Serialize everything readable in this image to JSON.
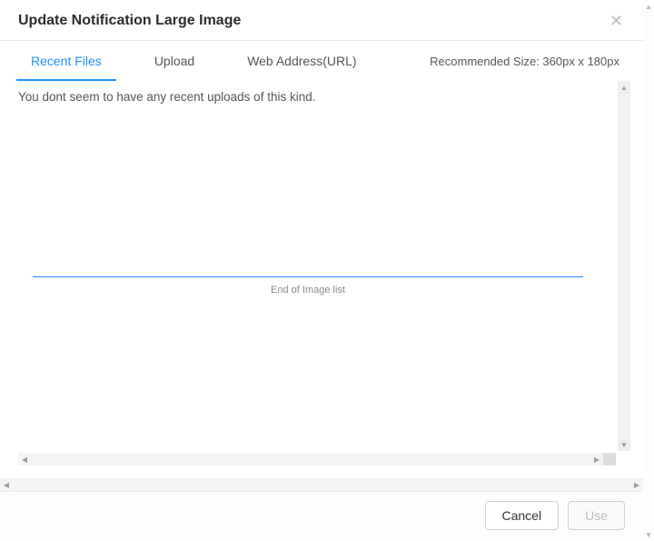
{
  "header": {
    "title": "Update Notification Large Image"
  },
  "tabs": {
    "recent": "Recent Files",
    "upload": "Upload",
    "url": "Web Address(URL)"
  },
  "recommended": "Recommended Size: 360px x 180px",
  "content": {
    "empty_message": "You dont seem to have any recent uploads of this kind.",
    "end_label": "End of Image list"
  },
  "footer": {
    "cancel": "Cancel",
    "use": "Use"
  }
}
